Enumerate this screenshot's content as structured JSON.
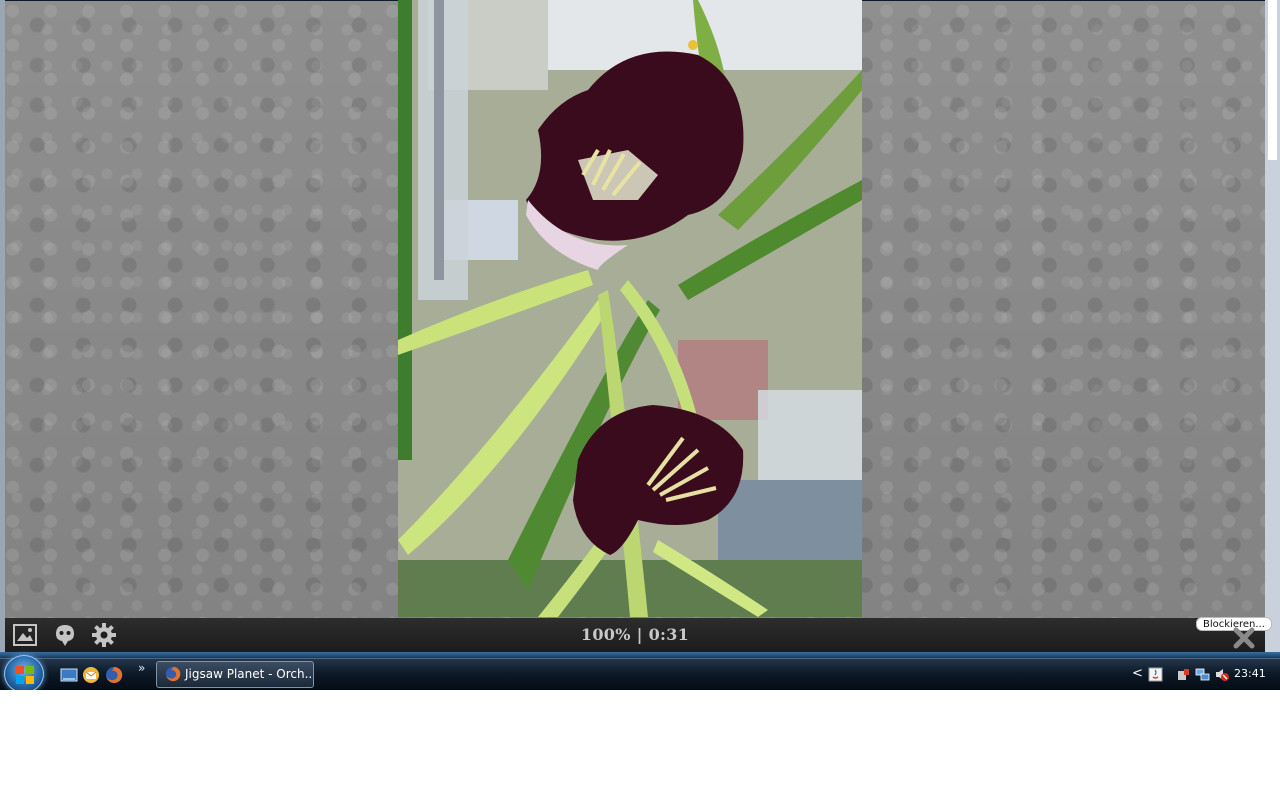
{
  "jigsaw": {
    "progress_text": "100% | 0:31",
    "tooltip": "Blockieren...",
    "toolbar_icons": [
      "image-icon",
      "ghost-icon",
      "gear-icon"
    ],
    "close_icon": "close-icon"
  },
  "taskbar": {
    "start_icon": "windows-orb-icon",
    "quick_launch": [
      "show-desktop-icon",
      "mail-icon",
      "firefox-icon"
    ],
    "quick_launch_more": "»",
    "active_task": "Jigsaw Planet - Orch...",
    "tray_arrow": "<",
    "tray_icons": [
      "java-icon",
      "safely-remove-icon",
      "network-icon",
      "volume-muted-icon"
    ],
    "clock": "23:41"
  },
  "colors": {
    "workspace": "#8c8c8c",
    "toolbar": "#1f1f1f",
    "progress_text": "#c8c8c8",
    "taskbar": "#0d1a28"
  }
}
